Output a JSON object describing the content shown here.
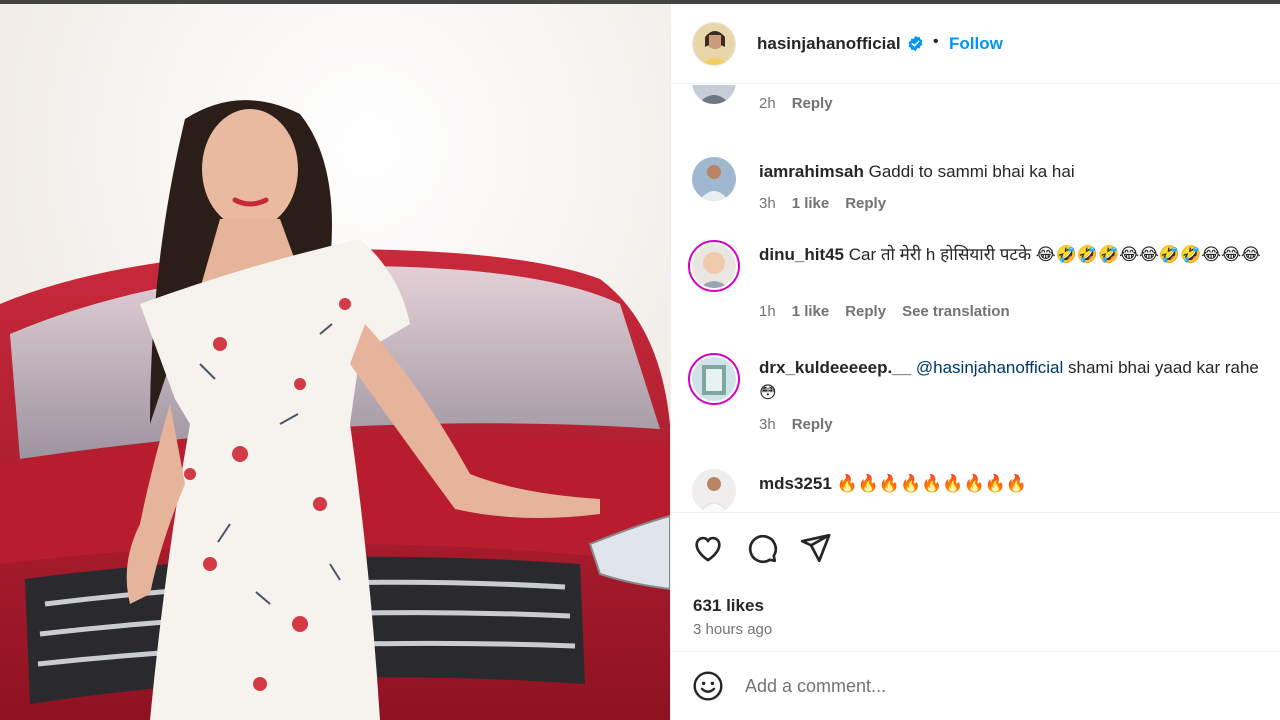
{
  "post": {
    "username": "hasinjahanofficial",
    "verified_icon": "verified-badge-icon",
    "follow_label": "Follow",
    "separator": "•"
  },
  "comments": [
    {
      "user": "",
      "text": "",
      "time": "2h",
      "likes": "",
      "reply": "Reply",
      "translate": ""
    },
    {
      "user": "iamrahimsah",
      "text": "Gaddi to sammi bhai ka hai",
      "time": "3h",
      "likes": "1 like",
      "reply": "Reply",
      "translate": ""
    },
    {
      "user": "dinu_hit45",
      "text": "Car तो मेरी h होसियारी पटके 😂🤣🤣🤣😂😂🤣🤣😂😂😂",
      "time": "1h",
      "likes": "1 like",
      "reply": "Reply",
      "translate": "See translation"
    },
    {
      "user": "drx_kuldeeeeep.__",
      "mention": "@hasinjahanofficial",
      "text": "shami bhai yaad kar rahe😳",
      "time": "3h",
      "likes": "",
      "reply": "Reply",
      "translate": ""
    },
    {
      "user": "mds3251",
      "text": "🔥🔥🔥🔥🔥🔥🔥🔥🔥",
      "time": "",
      "likes": "",
      "reply": "",
      "translate": ""
    }
  ],
  "actions": {
    "like_icon": "heart-icon",
    "comment_icon": "comment-icon",
    "share_icon": "send-icon",
    "likes": "631 likes",
    "time_ago": "3 hours ago"
  },
  "add_comment": {
    "emoji_icon": "emoji-icon",
    "placeholder": "Add a comment..."
  },
  "colors": {
    "accent": "#0095f6",
    "mention": "#00376b",
    "story_ring": "#d300c5",
    "car": "#b3182b"
  }
}
